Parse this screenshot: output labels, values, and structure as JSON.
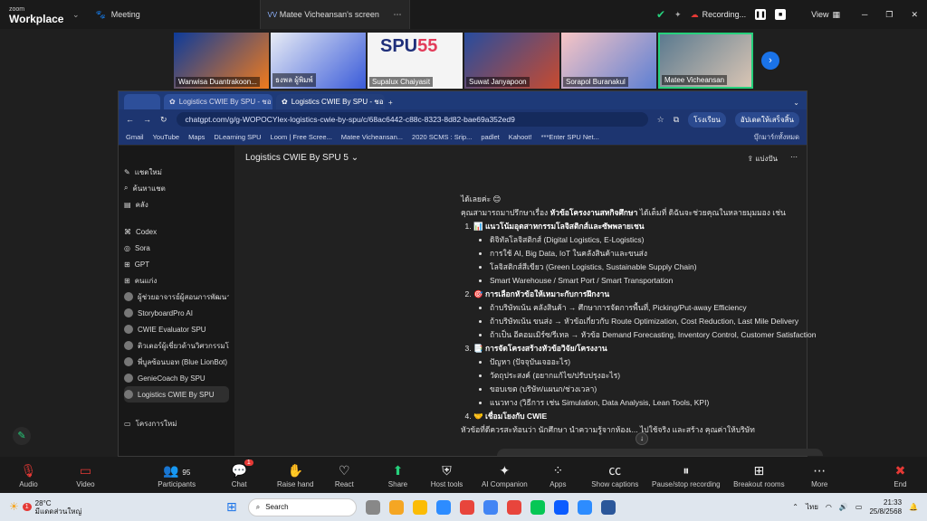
{
  "zoom": {
    "logo_small": "zoom",
    "logo_big": "Workplace",
    "tabs": [
      {
        "label": "Meeting"
      },
      {
        "label": "Matee Vicheansan's screen",
        "prefix": "VV"
      }
    ],
    "recording_label": "Recording...",
    "view_label": "View"
  },
  "participants_strip": [
    {
      "name": "Wanwisa Duantrakoon..."
    },
    {
      "name": "ธงพล ผู้พิมพ์"
    },
    {
      "name": "Supalux Chaiyasit"
    },
    {
      "name": "Suwat Janyapoon"
    },
    {
      "name": "Sorapol Buranakul"
    },
    {
      "name": "Matee Vicheansan"
    }
  ],
  "browser": {
    "tabs": [
      {
        "label": "Logistics CWIE By SPU - ชอ"
      },
      {
        "label": "Logistics CWIE By SPU - ชอ"
      }
    ],
    "url": "chatgpt.com/g/g-WOPOCYlex-logistics-cwie-by-spu/c/68ac6442-c88c-8323-8d82-bae69a352ed9",
    "right_btn1": "โรงเรียน",
    "right_btn2": "อัปเดตให้เสร็จสิ้น",
    "bookmarks": [
      "Gmail",
      "YouTube",
      "Maps",
      "DLearning SPU",
      "Loom | Free Scree...",
      "Matee Vicheansan...",
      "2020 SCMS : Srip...",
      "padlet",
      "Kahoot!",
      "***Enter SPU Net..."
    ],
    "bookmarks_all": "บุ๊กมาร์กทั้งหมด"
  },
  "sidebar": {
    "items": [
      {
        "label": "แชตใหม่"
      },
      {
        "label": "ค้นหาแชต"
      },
      {
        "label": "คลัง"
      },
      {
        "label": "Codex"
      },
      {
        "label": "Sora"
      },
      {
        "label": "GPT"
      },
      {
        "label": "คนแก่ง"
      },
      {
        "label": "ผู้ช่วยอาจารย์ผู้สอนการพัฒนา..."
      },
      {
        "label": "StoryboardPro AI"
      },
      {
        "label": "CWIE Evaluator SPU"
      },
      {
        "label": "ติวเตอร์ผู้เชี่ยวด้านวิศวกรรมโ..."
      },
      {
        "label": "พี่บูลซ้อนบอท (Blue LionBot)"
      },
      {
        "label": "GenieCoach By SPU"
      },
      {
        "label": "Logistics CWIE By SPU"
      },
      {
        "label": "โครงการใหม่"
      }
    ]
  },
  "main": {
    "title": "Logistics CWIE By SPU 5",
    "share_label": "แบ่งปัน",
    "greeting": "ได้เลยค่ะ 😊",
    "intro_a": "คุณสามารถมาปรึกษาเรื่อง ",
    "intro_b": "หัวข้อโครงงานสหกิจศึกษา",
    "intro_c": " ได้เต็มที่ ดิฉันจะช่วยคุณในหลายมุมมอง เช่น",
    "sections": [
      {
        "title": "📊 แนวโน้มอุตสาหกรรมโลจิสติกส์และซัพพลายเชน",
        "items": [
          "ดิจิทัลโลจิสติกส์ (Digital Logistics, E-Logistics)",
          "การใช้ AI, Big Data, IoT ในคลังสินค้าและขนส่ง",
          "โลจิสติกส์สีเขียว (Green Logistics, Sustainable Supply Chain)",
          "Smart Warehouse / Smart Port / Smart Transportation"
        ]
      },
      {
        "title": "🎯 การเลือกหัวข้อให้เหมาะกับการฝึกงาน",
        "items": [
          "ถ้าบริษัทเน้น คลังสินค้า → ศึกษาการจัดการพื้นที่, Picking/Put-away Efficiency",
          "ถ้าบริษัทเน้น ขนส่ง → หัวข้อเกี่ยวกับ Route Optimization, Cost Reduction, Last Mile Delivery",
          "ถ้าเป็น อีคอมเมิร์ซ/รีเทล → หัวข้อ Demand Forecasting, Inventory Control, Customer Satisfaction"
        ]
      },
      {
        "title": "📑 การจัดโครงสร้างหัวข้อวิจัย/โครงงาน",
        "items": [
          "ปัญหา (ปัจจุบันเจออะไร)",
          "วัตถุประสงค์ (อยากแก้ไข/ปรับปรุงอะไร)",
          "ขอบเขต (บริษัท/แผนก/ช่วงเวลา)",
          "แนวทาง (วิธีการ เช่น Simulation, Data Analysis, Lean Tools, KPI)"
        ]
      },
      {
        "title": "🤝 เชื่อมโยงกับ CWIE",
        "items": []
      }
    ],
    "closing": "หัวข้อที่ดีควรสะท้อนว่า นักศึกษา นำความรู้จากห้องเ... ไปใช้จริง และสร้าง คุณค่าให้บริษัท"
  },
  "toolbar": {
    "buttons": [
      {
        "label": "Audio",
        "icon": "mic-off-icon"
      },
      {
        "label": "Video",
        "icon": "video-off-icon"
      },
      {
        "label": "Participants",
        "count": "95"
      },
      {
        "label": "Chat",
        "badge": "1"
      },
      {
        "label": "Raise hand"
      },
      {
        "label": "React"
      },
      {
        "label": "Share"
      },
      {
        "label": "Host tools"
      },
      {
        "label": "AI Companion"
      },
      {
        "label": "Apps"
      },
      {
        "label": "Show captions"
      },
      {
        "label": "Pause/stop recording"
      },
      {
        "label": "Breakout rooms"
      },
      {
        "label": "More"
      },
      {
        "label": "End"
      }
    ]
  },
  "taskbar": {
    "temp": "28°C",
    "weather": "มีแดดส่วนใหญ่",
    "search": "Search",
    "lang": "ไทย",
    "time": "21:33",
    "date": "25/8/2568",
    "weather_badge": "1"
  }
}
